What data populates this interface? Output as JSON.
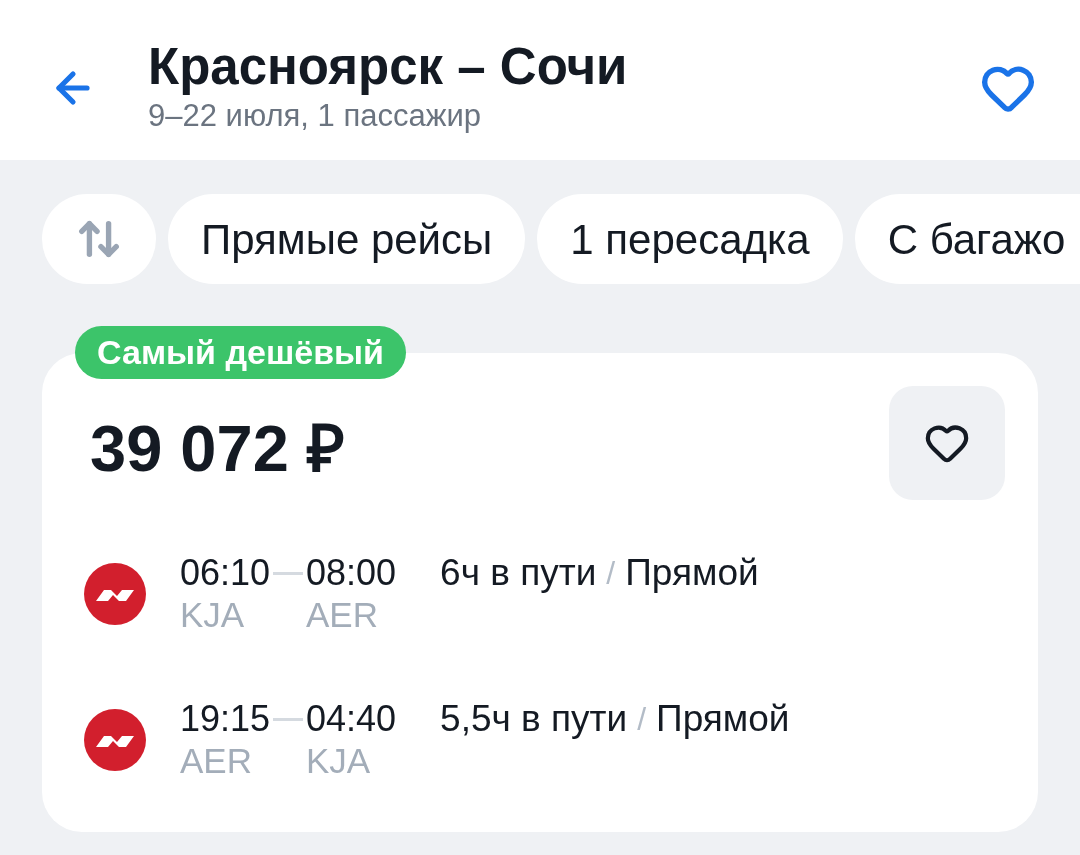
{
  "header": {
    "title": "Красноярск – Сочи",
    "subtitle": "9–22 июля, 1 пассажир"
  },
  "filters": [
    {
      "label": "Прямые рейсы",
      "selected": false
    },
    {
      "label": "1 пересадка",
      "selected": false
    },
    {
      "label": "С багажо",
      "selected": false
    }
  ],
  "offer": {
    "badge": "Самый дешёвый",
    "price": "39 072 ₽",
    "flights": [
      {
        "departure": "06:10",
        "arrival": "08:00",
        "from": "KJA",
        "to": "AER",
        "duration": "6ч в пути",
        "separator": "/",
        "stops": "Прямой"
      },
      {
        "departure": "19:15",
        "arrival": "04:40",
        "from": "AER",
        "to": "KJA",
        "duration": "5,5ч в пути",
        "separator": "/",
        "stops": "Прямой"
      }
    ]
  }
}
